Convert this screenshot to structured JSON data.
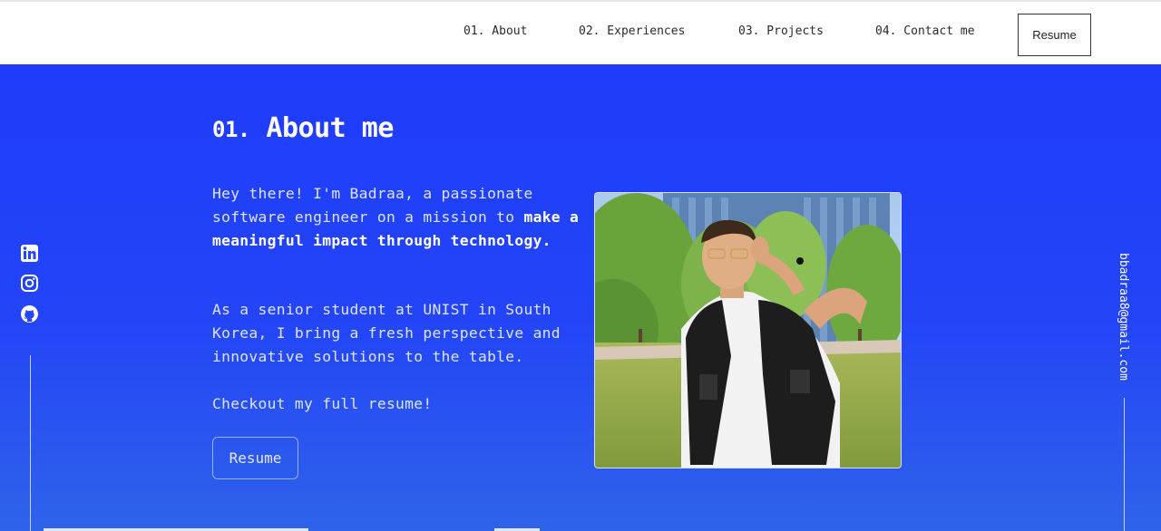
{
  "nav": {
    "items": [
      {
        "label": "01. About"
      },
      {
        "label": "02. Experiences"
      },
      {
        "label": "03. Projects"
      },
      {
        "label": "04. Contact me"
      }
    ],
    "resume_label": "Resume"
  },
  "about": {
    "title_number": "01.",
    "title_text": "About me",
    "intro_plain": "Hey there! I'm Badraa, a passionate software engineer on a mission to ",
    "intro_bold": "make a meaningful impact through technology.",
    "paragraph2": "As a senior student at UNIST in South Korea, I bring a fresh perspective and innovative solutions to the table.",
    "paragraph3": "Checkout my full resume!",
    "resume_button": "Resume"
  },
  "social": {
    "icons": [
      "linkedin-icon",
      "instagram-icon",
      "github-icon"
    ]
  },
  "contact": {
    "email": "bbadraa8@gmail.com"
  },
  "colors": {
    "hero_top": "#1f3cfb",
    "hero_bottom": "#2f63ea",
    "accent_white": "#ffffff"
  }
}
